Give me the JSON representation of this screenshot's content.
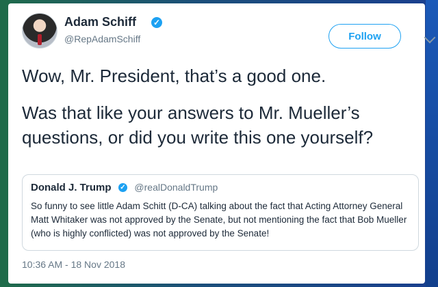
{
  "tweet": {
    "author_name": "Adam Schiff",
    "author_handle": "@RepAdamSchiff",
    "follow_label": "Follow",
    "text_line1": "Wow, Mr. President, that’s a good one.",
    "text_line2": "Was that like your answers to Mr. Mueller’s questions, or did you write this one yourself?",
    "timestamp": "10:36 AM - 18 Nov 2018"
  },
  "quoted_tweet": {
    "author_name": "Donald J. Trump",
    "author_handle": "@realDonaldTrump",
    "text": "So funny to see little Adam Schitt (D-CA) talking about the fact that Acting Attorney General Matt Whitaker was not approved by the Senate, but not mentioning the fact that Bob Mueller (who is highly conflicted) was not approved by the Senate!"
  },
  "colors": {
    "accent": "#1da1f2",
    "text": "#1c2938",
    "muted": "#657786"
  },
  "icons": {
    "verified": "verified-badge-icon",
    "menu": "chevron-down-icon"
  }
}
